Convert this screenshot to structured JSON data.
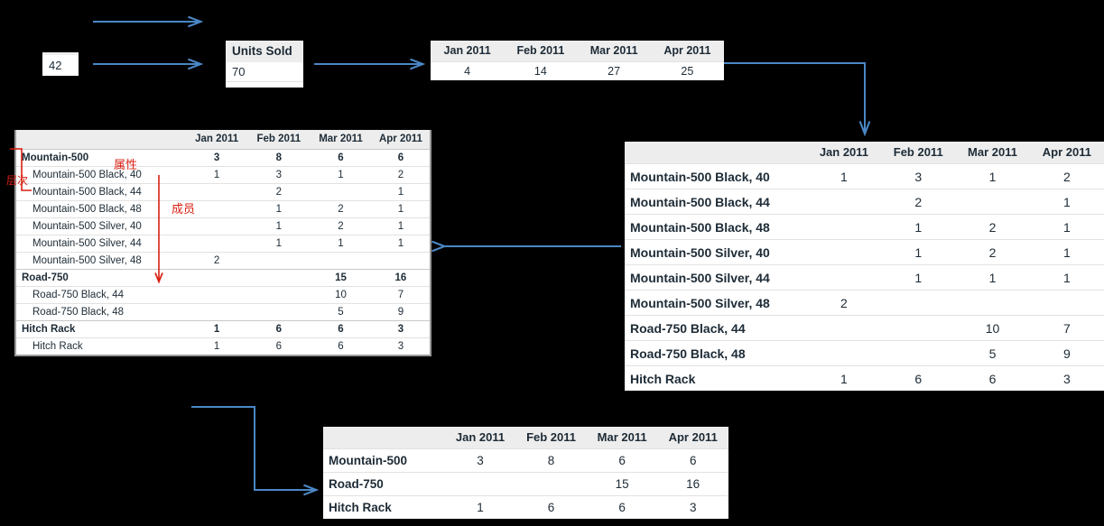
{
  "colors": {
    "arrow": "#4a87c5",
    "annotation": "#d81f11",
    "header_bg": "#ededed",
    "text": "#1d2b36",
    "background": "#000000"
  },
  "value_box": {
    "value": "42"
  },
  "measure_box": {
    "header": "Units Sold",
    "value": "70"
  },
  "months_table": {
    "columns": [
      "Jan 2011",
      "Feb 2011",
      "Mar 2011",
      "Apr 2011"
    ],
    "values": [
      "4",
      "14",
      "27",
      "25"
    ]
  },
  "hierarchy_table": {
    "columns": [
      "",
      "Jan 2011",
      "Feb 2011",
      "Mar 2011",
      "Apr 2011"
    ],
    "rows": [
      {
        "level": 0,
        "label": "Mountain-500",
        "values": [
          "3",
          "8",
          "6",
          "6"
        ]
      },
      {
        "level": 1,
        "label": "Mountain-500 Black, 40",
        "values": [
          "1",
          "3",
          "1",
          "2"
        ]
      },
      {
        "level": 1,
        "label": "Mountain-500 Black, 44",
        "values": [
          "",
          "2",
          "",
          "1"
        ]
      },
      {
        "level": 1,
        "label": "Mountain-500 Black, 48",
        "values": [
          "",
          "1",
          "2",
          "1"
        ]
      },
      {
        "level": 1,
        "label": "Mountain-500 Silver, 40",
        "values": [
          "",
          "1",
          "2",
          "1"
        ]
      },
      {
        "level": 1,
        "label": "Mountain-500 Silver, 44",
        "values": [
          "",
          "1",
          "1",
          "1"
        ]
      },
      {
        "level": 1,
        "label": "Mountain-500 Silver, 48",
        "values": [
          "2",
          "",
          "",
          ""
        ]
      },
      {
        "level": 0,
        "label": "Road-750",
        "values": [
          "",
          "",
          "15",
          "16"
        ]
      },
      {
        "level": 1,
        "label": "Road-750 Black, 44",
        "values": [
          "",
          "",
          "10",
          "7"
        ]
      },
      {
        "level": 1,
        "label": "Road-750 Black, 48",
        "values": [
          "",
          "",
          "5",
          "9"
        ]
      },
      {
        "level": 0,
        "label": "Hitch Rack",
        "values": [
          "1",
          "6",
          "6",
          "3"
        ]
      },
      {
        "level": 1,
        "label": "Hitch Rack",
        "values": [
          "1",
          "6",
          "6",
          "3"
        ]
      }
    ]
  },
  "members_table": {
    "columns": [
      "",
      "Jan 2011",
      "Feb 2011",
      "Mar 2011",
      "Apr 2011"
    ],
    "rows": [
      {
        "label": "Mountain-500 Black, 40",
        "values": [
          "1",
          "3",
          "1",
          "2"
        ]
      },
      {
        "label": "Mountain-500 Black, 44",
        "values": [
          "",
          "2",
          "",
          "1"
        ]
      },
      {
        "label": "Mountain-500 Black, 48",
        "values": [
          "",
          "1",
          "2",
          "1"
        ]
      },
      {
        "label": "Mountain-500 Silver, 40",
        "values": [
          "",
          "1",
          "2",
          "1"
        ]
      },
      {
        "label": "Mountain-500 Silver, 44",
        "values": [
          "",
          "1",
          "1",
          "1"
        ]
      },
      {
        "label": "Mountain-500 Silver, 48",
        "values": [
          "2",
          "",
          "",
          ""
        ]
      },
      {
        "label": "Road-750 Black, 44",
        "values": [
          "",
          "",
          "10",
          "7"
        ]
      },
      {
        "label": "Road-750 Black, 48",
        "values": [
          "",
          "",
          "5",
          "9"
        ]
      },
      {
        "label": "Hitch Rack",
        "values": [
          "1",
          "6",
          "6",
          "3"
        ]
      }
    ]
  },
  "products_table": {
    "columns": [
      "",
      "Jan 2011",
      "Feb 2011",
      "Mar 2011",
      "Apr 2011"
    ],
    "rows": [
      {
        "label": "Mountain-500",
        "values": [
          "3",
          "8",
          "6",
          "6"
        ]
      },
      {
        "label": "Road-750",
        "values": [
          "",
          "",
          "15",
          "16"
        ]
      },
      {
        "label": "Hitch Rack",
        "values": [
          "1",
          "6",
          "6",
          "3"
        ]
      }
    ]
  },
  "annotations": {
    "attribute": "属性",
    "member": "成员",
    "hierarchy": "层次"
  }
}
